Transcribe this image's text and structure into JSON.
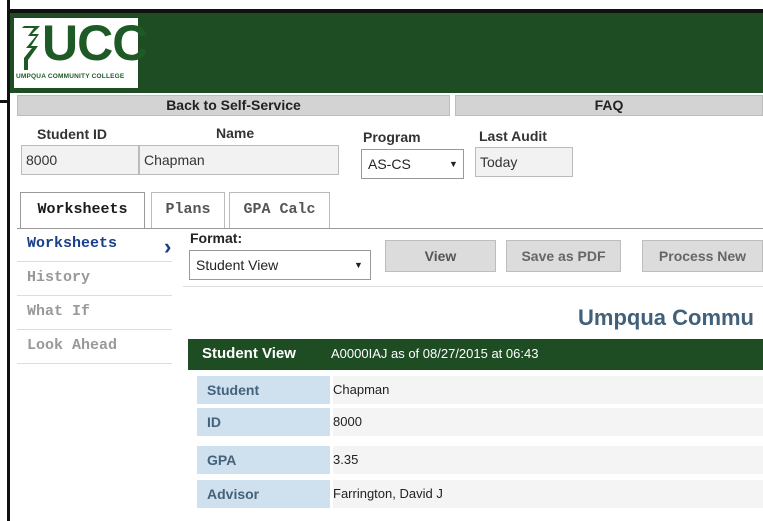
{
  "brand": {
    "logo_text": "UCC",
    "logo_subtext": "UMPQUA COMMUNITY COLLEGE",
    "primary_color": "#1e4d24",
    "accent_color": "#1a3f8a"
  },
  "navbar": {
    "back_label": "Back to Self-Service",
    "faq_label": "FAQ"
  },
  "student": {
    "id_label": "Student ID",
    "id_value": "8000",
    "name_label": "Name",
    "name_value": "Chapman",
    "program_label": "Program",
    "program_value": "AS-CS",
    "last_audit_label": "Last Audit",
    "last_audit_value": "Today"
  },
  "tabs": [
    {
      "label": "Worksheets",
      "active": true
    },
    {
      "label": "Plans",
      "active": false
    },
    {
      "label": "GPA Calc",
      "active": false
    }
  ],
  "sidebar": {
    "items": [
      {
        "label": "Worksheets",
        "active": true
      },
      {
        "label": "History",
        "active": false
      },
      {
        "label": "What If",
        "active": false
      },
      {
        "label": "Look Ahead",
        "active": false
      }
    ]
  },
  "toolbar": {
    "format_label": "Format:",
    "format_value": "Student View",
    "view_label": "View",
    "pdf_label": "Save as PDF",
    "process_label": "Process New"
  },
  "page_heading": "Umpqua Commu",
  "student_view": {
    "title": "Student View",
    "info": "A0000IAJ as of 08/27/2015 at 06:43",
    "rows": [
      {
        "label": "Student",
        "value": "Chapman"
      },
      {
        "label": "ID",
        "value": "8000"
      },
      {
        "label": "GPA",
        "value": "3.35"
      },
      {
        "label": "Advisor",
        "value": "Farrington, David J"
      }
    ]
  }
}
